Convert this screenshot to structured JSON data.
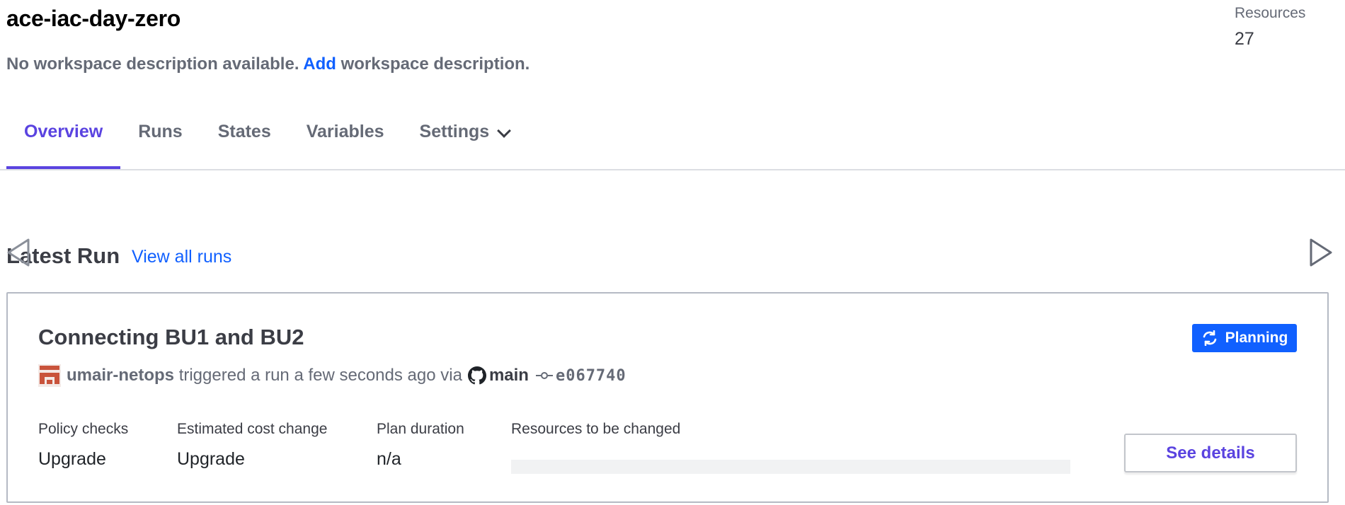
{
  "workspace": {
    "name": "ace-iac-day-zero",
    "description_prefix": "No workspace description available.",
    "description_link": "Add",
    "description_suffix": "workspace description."
  },
  "resources": {
    "label": "Resources",
    "count": "27"
  },
  "tabs": [
    {
      "label": "Overview",
      "active": true
    },
    {
      "label": "Runs",
      "active": false
    },
    {
      "label": "States",
      "active": false
    },
    {
      "label": "Variables",
      "active": false
    },
    {
      "label": "Settings",
      "active": false,
      "icon": "chevron-down-icon"
    }
  ],
  "latest_run": {
    "heading": "Latest Run",
    "view_all_link": "View all runs",
    "title": "Connecting BU1 and BU2",
    "status": "Planning",
    "status_icon": "sync-icon",
    "user": "umair-netops",
    "trigger_text": "triggered a run a few seconds ago via",
    "vcs_icon": "github-icon",
    "branch": "main",
    "commit_icon": "commit-icon",
    "commit": "e067740",
    "stats": [
      {
        "label": "Policy checks",
        "value": "Upgrade"
      },
      {
        "label": "Estimated cost change",
        "value": "Upgrade"
      },
      {
        "label": "Plan duration",
        "value": "n/a"
      },
      {
        "label": "Resources to be changed",
        "value": ""
      }
    ],
    "details_button": "See details"
  },
  "colors": {
    "accent": "#5a43e0",
    "link": "#1060ff",
    "muted_text": "#656a76",
    "status_planning": "#1060ff"
  }
}
